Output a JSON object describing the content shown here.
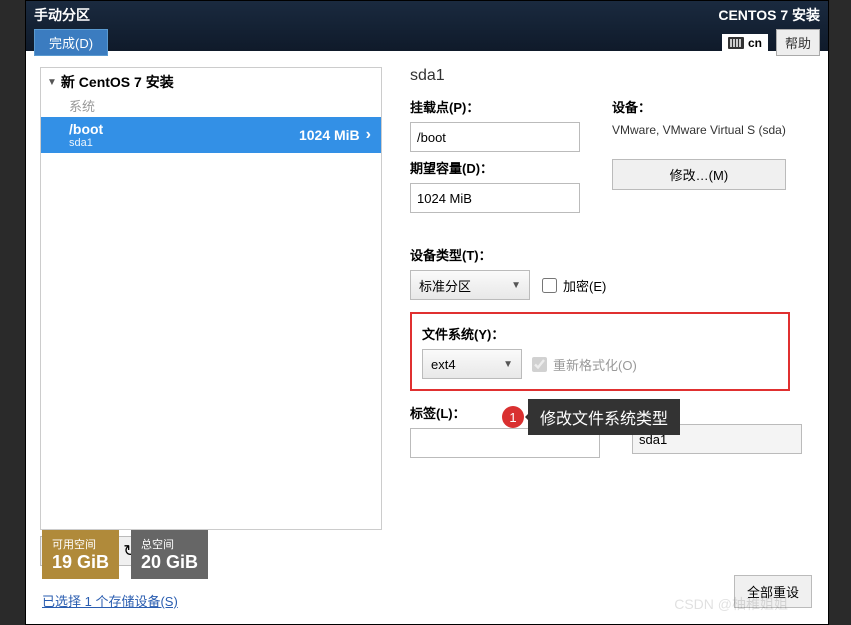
{
  "header": {
    "title": "手动分区",
    "done": "完成(D)",
    "install_title": "CENTOS 7 安装",
    "lang": "cn",
    "help": "帮助"
  },
  "sidebar": {
    "tree_title": "新 CentOS 7 安装",
    "system_label": "系统",
    "part": {
      "name": "/boot",
      "dev": "sda1",
      "size": "1024 MiB"
    },
    "buttons": {
      "add": "+",
      "remove": "−",
      "reload": "↻"
    }
  },
  "details": {
    "device_heading": "sda1",
    "mount_label": "挂载点(P)：",
    "mount_value": "/boot",
    "capacity_label": "期望容量(D)：",
    "capacity_value": "1024 MiB",
    "devices_label": "设备：",
    "devices_text": "VMware, VMware Virtual S (sda)",
    "modify": "修改…(M)",
    "type_label": "设备类型(T)：",
    "type_value": "标准分区",
    "encrypt": "加密(E)",
    "fs_label": "文件系统(Y)：",
    "fs_value": "ext4",
    "reformat": "重新格式化(O)",
    "tag_label": "标签(L)：",
    "tag_value": "",
    "name_value": "sda1",
    "reset_all": "全部重设"
  },
  "annotation": {
    "num": "1",
    "text": "修改文件系统类型"
  },
  "footer": {
    "avail_label": "可用空间",
    "avail_value": "19 GiB",
    "total_label": "总空间",
    "total_value": "20 GiB",
    "storage_link": "已选择 1 个存储设备(S)"
  },
  "watermark": "CSDN @柚稚姐姐"
}
